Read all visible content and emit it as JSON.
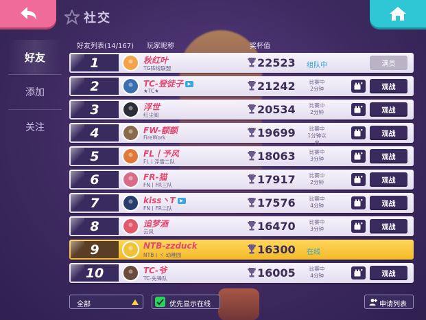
{
  "header": {
    "title": "社交"
  },
  "nav": [
    {
      "label": "好友",
      "active": true
    },
    {
      "label": "添加",
      "active": false
    },
    {
      "label": "关注",
      "active": false
    }
  ],
  "table": {
    "col_list": "好友列表(14/167)",
    "col_nick": "玩家昵称",
    "col_trophy": "奖杯值"
  },
  "friends": [
    {
      "rank": "1",
      "name": "秋红叶",
      "sub": "TG阵线联盟",
      "trophies": "22523",
      "status": "组队中",
      "action": "满员",
      "action_type": "full",
      "badge": "",
      "avatar_color": "#f4a34a"
    },
    {
      "rank": "2",
      "name": "TC-登徒子",
      "sub": "★TC★",
      "trophies": "21242",
      "status": "比赛中\n2分钟",
      "action": "观战",
      "action_type": "watch",
      "badge": "tv",
      "avatar_color": "#3c6fb0"
    },
    {
      "rank": "3",
      "name": "浮世",
      "sub": "红尘阁",
      "trophies": "20534",
      "status": "比赛中\n2分钟",
      "action": "观战",
      "action_type": "watch",
      "badge": "",
      "avatar_color": "#2b2b3a"
    },
    {
      "rank": "4",
      "name": "FW-额额",
      "sub": "FireWork",
      "trophies": "19699",
      "status": "比赛中\n1分钟以内",
      "action": "观战",
      "action_type": "watch",
      "badge": "",
      "avatar_color": "#8a6a4a"
    },
    {
      "rank": "5",
      "name": "FL丨予风",
      "sub": "FL丨浮雪二队",
      "trophies": "18063",
      "status": "比赛中\n3分钟",
      "action": "观战",
      "action_type": "watch",
      "badge": "",
      "avatar_color": "#e07a3a"
    },
    {
      "rank": "6",
      "name": "FR-猫",
      "sub": "FN丨FR三队",
      "trophies": "17917",
      "status": "比赛中\n2分钟",
      "action": "观战",
      "action_type": "watch",
      "badge": "",
      "avatar_color": "#d96b8a"
    },
    {
      "rank": "7",
      "name": "kiss丶T",
      "sub": "FN丨FR二队",
      "trophies": "17576",
      "status": "比赛中\n4分钟",
      "action": "观战",
      "action_type": "watch",
      "badge": "tv",
      "avatar_color": "#2a3d6a"
    },
    {
      "rank": "8",
      "name": "追梦酒",
      "sub": "云风",
      "trophies": "16470",
      "status": "比赛中\n3分钟",
      "action": "观战",
      "action_type": "watch",
      "badge": "",
      "avatar_color": "#e05a6a"
    },
    {
      "rank": "9",
      "name": "NTB-zzduck",
      "sub": "NTB丨ヾ 幼稚园",
      "trophies": "16300",
      "status": "在线",
      "action": "",
      "action_type": "none",
      "badge": "",
      "avatar_color": "#f0c23a"
    },
    {
      "rank": "10",
      "name": "TC-爷",
      "sub": "TC-先锋队",
      "trophies": "16005",
      "status": "比赛中\n4分钟",
      "action": "观战",
      "action_type": "watch",
      "badge": "",
      "avatar_color": "#6a4a3a"
    }
  ],
  "bottom": {
    "filter_label": "全部",
    "online_first_label": "优先显示在线",
    "apply_label": "申请列表"
  }
}
